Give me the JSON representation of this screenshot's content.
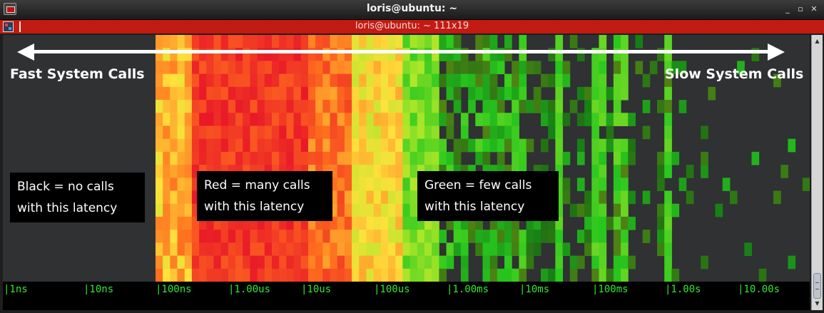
{
  "window": {
    "title": "loris@ubuntu: ~",
    "minimize_glyph": "_",
    "maximize_glyph": "▫",
    "close_glyph": "✕"
  },
  "tab": {
    "title": "loris@ubuntu: ~ 111x19"
  },
  "annotations": {
    "fast_label": "Fast System Calls",
    "slow_label": "Slow System Calls",
    "legend_black": {
      "line1": "Black = no calls",
      "line2": "with this latency"
    },
    "legend_red": {
      "line1": "Red = many calls",
      "line2": "with this latency"
    },
    "legend_green": {
      "line1": "Green = few calls",
      "line2": "with this latency"
    }
  },
  "axis": {
    "ticks": [
      "|1ns",
      "|10ns",
      "|100ns",
      "|1.00us",
      "|10us",
      "|100us",
      "|1.00ms",
      "|10ms",
      "|100ms",
      "|1.00s",
      "|10.00s"
    ]
  },
  "scrollbar": {
    "up_glyph": "▲",
    "down_glyph": "▼"
  },
  "colors": {
    "titlebar": "#2a2a2a",
    "tabbar": "#c21b12",
    "terminal_bg": "#2f3133",
    "axis_text": "#2ee82e",
    "hot": "#e8102a",
    "warm": "#ffd23a",
    "cool": "#1fa81f"
  },
  "chart_data": {
    "type": "heatmap",
    "x_scale": "log",
    "x_tick_labels": [
      "1ns",
      "10ns",
      "100ns",
      "1.00us",
      "10us",
      "100us",
      "1.00ms",
      "10ms",
      "100ms",
      "1.00s",
      "10.00s"
    ],
    "rows": 19,
    "columns": 111,
    "legend": [
      "Black = no calls with this latency",
      "Red = many calls with this latency",
      "Green = few calls with this latency"
    ]
  }
}
